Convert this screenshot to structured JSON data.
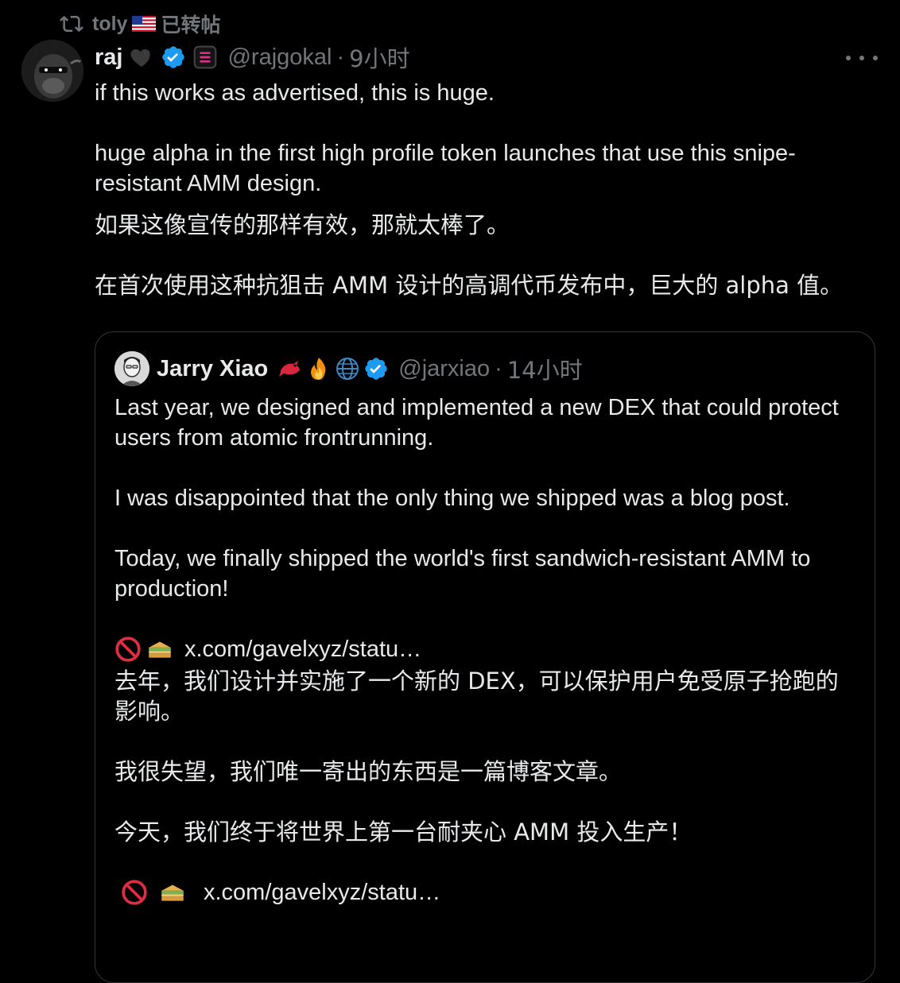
{
  "repost": {
    "user": "toly",
    "label": "已转帖"
  },
  "post": {
    "name": "raj",
    "handle": "@rajgokal",
    "dot": "·",
    "time": "9小时",
    "text_en": "if this works as advertised, this is huge.\n\nhuge alpha in the first high profile token launches that use this snipe-resistant AMM design.",
    "text_cn": "如果这像宣传的那样有效，那就太棒了。\n\n在首次使用这种抗狙击 AMM 设计的高调代币发布中，巨大的 alpha 值。"
  },
  "quote": {
    "name": "Jarry Xiao",
    "handle": "@jarxiao",
    "dot": "·",
    "time": "14小时",
    "text_en": "Last year, we designed and implemented a new DEX that could protect users from atomic frontrunning.\n\nI was disappointed that the only thing we shipped was a blog post.\n\nToday, we finally shipped the world's first sandwich-resistant AMM to production!",
    "link_1": "x.com/gavelxyz/statu…",
    "text_cn": "去年，我们设计并实施了一个新的 DEX，可以保护用户免受原子抢跑的影响。\n\n我很失望，我们唯一寄出的东西是一篇博客文章。\n\n今天，我们终于将世界上第一台耐夹心 AMM 投入生产！",
    "link_2": "x.com/gavelxyz/statu…"
  },
  "colors": {
    "background": "#000000",
    "text": "#e7e9ea",
    "secondary": "#71767b",
    "verified": "#1d9bf0",
    "border": "#333639"
  },
  "icons": [
    "repost-icon",
    "us-flag-icon",
    "black-heart-icon",
    "verified-badge-icon",
    "app-badge-icon",
    "more-icon",
    "bird-emoji-icon",
    "fire-emoji-icon",
    "globe-emoji-icon",
    "no-entry-emoji-icon",
    "sandwich-emoji-icon"
  ]
}
